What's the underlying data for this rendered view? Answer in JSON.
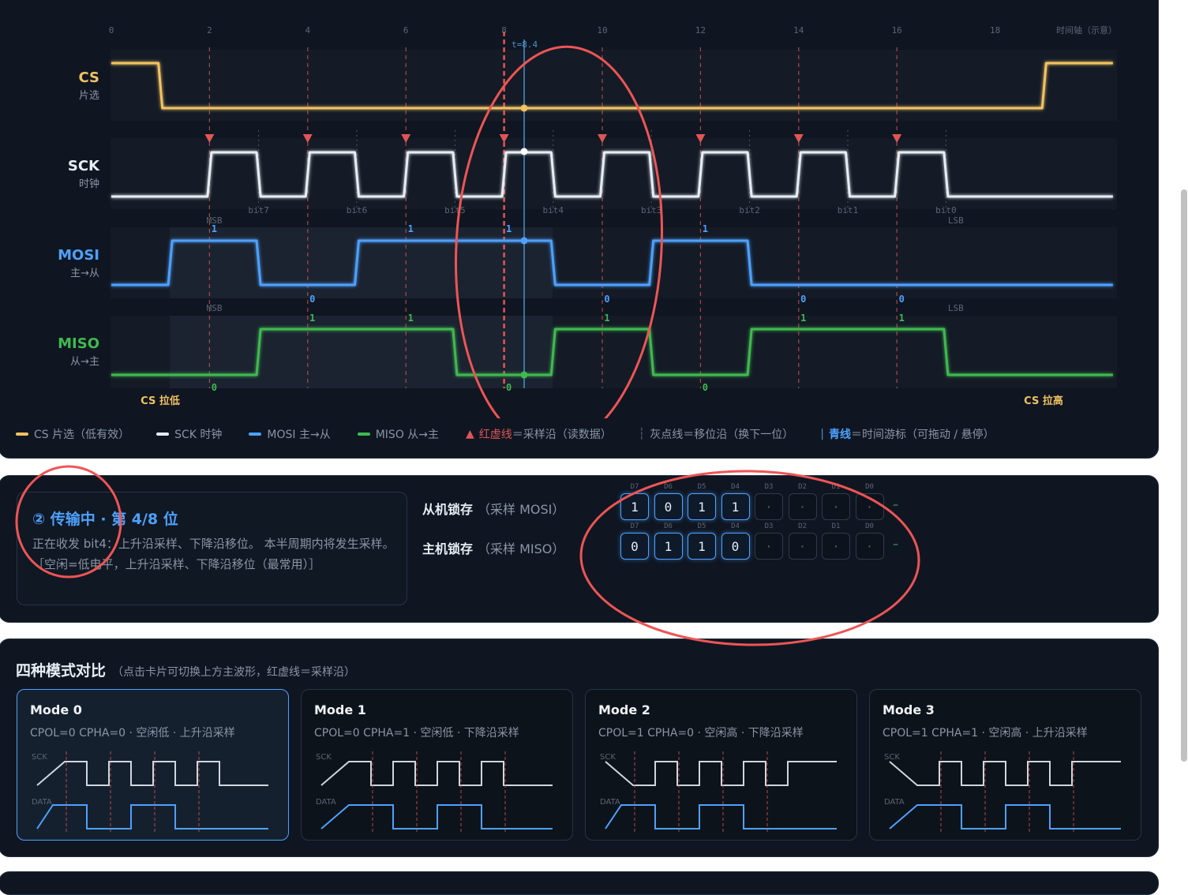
{
  "timeline": {
    "axis_label": "时间轴（示意）",
    "ticks": [
      "0",
      "2",
      "4",
      "6",
      "8",
      "10",
      "12",
      "14",
      "16",
      "18"
    ],
    "cursor_label": "t=8.4"
  },
  "signals": {
    "cs": {
      "name": "CS",
      "sub": "片选",
      "color": "#f2c263"
    },
    "sck": {
      "name": "SCK",
      "sub": "时钟",
      "color": "#e6edf3"
    },
    "mosi": {
      "name": "MOSI",
      "sub": "主→从",
      "color": "#4ea1ff"
    },
    "miso": {
      "name": "MISO",
      "sub": "从→主",
      "color": "#3fb950"
    }
  },
  "sck_bits": [
    "bit7",
    "bit6",
    "bit5",
    "bit4",
    "bit3",
    "bit2",
    "bit1",
    "bit0"
  ],
  "msb_label": "MSB",
  "lsb_label": "LSB",
  "mosi_values": [
    "1",
    "0",
    "1",
    "1",
    "0",
    "1",
    "0",
    "0"
  ],
  "miso_values": [
    "0",
    "1",
    "1",
    "0",
    "1",
    "0",
    "1",
    "1"
  ],
  "cs_low_label": "CS 拉低",
  "cs_high_label": "CS 拉高",
  "legend": {
    "cs": "CS 片选（低有效）",
    "sck": "SCK 时钟",
    "mosi": "MOSI 主→从",
    "miso": "MISO 从→主",
    "sample_strong": "红虚线",
    "sample_rest": "＝采样沿（读数据）",
    "shift": "灰点线＝移位沿（换下一位）",
    "cursor_strong": "青线",
    "cursor_rest": "＝时间游标（可拖动 / 悬停）"
  },
  "status": {
    "title": "② 传输中 · 第 4/8 位",
    "desc": "正在收发 bit4：上升沿采样、下降沿移位。 本半周期内将发生采样。　［空闲=低电平，上升沿采样、下降沿移位（最常用）］"
  },
  "registers": {
    "slave": {
      "label": "从机锁存",
      "sub": "（采样 MOSI）",
      "bits": [
        "1",
        "0",
        "1",
        "1",
        "·",
        "·",
        "·",
        "·"
      ],
      "tail": "–"
    },
    "master": {
      "label": "主机锁存",
      "sub": "（采样 MISO）",
      "bits": [
        "0",
        "1",
        "1",
        "0",
        "·",
        "·",
        "·",
        "·"
      ],
      "tail": "–"
    },
    "bit_names": [
      "D7",
      "D6",
      "D5",
      "D4",
      "D3",
      "D2",
      "D1",
      "D0"
    ]
  },
  "modes_section": {
    "title": "四种模式对比",
    "hint": "（点击卡片可切换上方主波形，红虚线＝采样沿）",
    "sck_label": "SCK",
    "data_label": "DATA",
    "modes": [
      {
        "name": "Mode 0",
        "desc": "CPOL=0 CPHA=0 · 空闲低 · 上升沿采样"
      },
      {
        "name": "Mode 1",
        "desc": "CPOL=0 CPHA=1 · 空闲低 · 下降沿采样"
      },
      {
        "name": "Mode 2",
        "desc": "CPOL=1 CPHA=0 · 空闲高 · 下降沿采样"
      },
      {
        "name": "Mode 3",
        "desc": "CPOL=1 CPHA=1 · 空闲高 · 上升沿采样"
      }
    ]
  },
  "colors": {
    "annotation": "#ee5555",
    "sample": "#e05555",
    "cursor": "#4a90c8"
  }
}
